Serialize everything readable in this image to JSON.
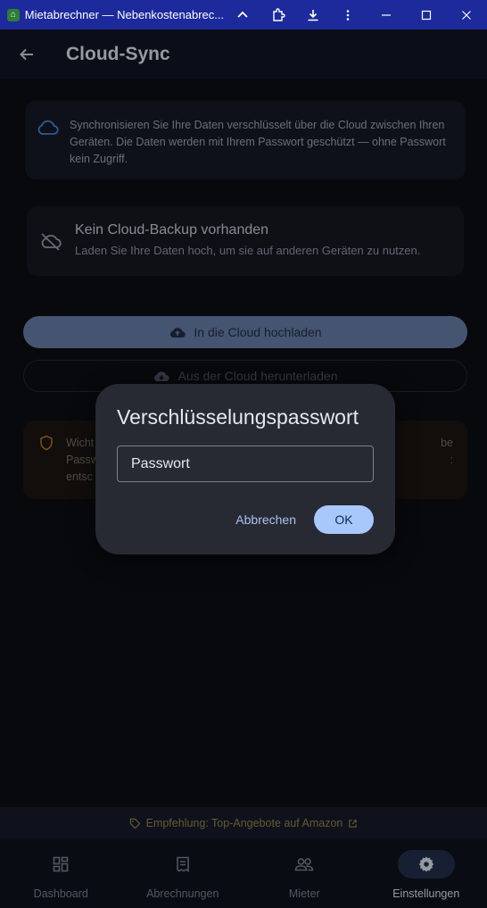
{
  "window": {
    "title": "Mietabrechner — Nebenkostenabrec..."
  },
  "header": {
    "title": "Cloud-Sync"
  },
  "info": {
    "text": "Synchronisieren Sie Ihre Daten verschlüsselt über die Cloud zwischen Ihren Geräten. Die Daten werden mit Ihrem Passwort geschützt — ohne Passwort kein Zugriff."
  },
  "status": {
    "title": "Kein Cloud-Backup vorhanden",
    "subtitle": "Laden Sie Ihre Daten hoch, um sie auf anderen Geräten zu nutzen."
  },
  "actions": {
    "upload_label": "In die Cloud hochladen",
    "download_label": "Aus der Cloud herunterladen"
  },
  "warning": {
    "line1_start": "Wicht",
    "line1_end": "be",
    "line2_start": "Passw",
    "line2_end": ":",
    "line3_start": "entsc"
  },
  "dialog": {
    "title": "Verschlüsselungspasswort",
    "placeholder": "Passwort",
    "cancel_label": "Abbrechen",
    "ok_label": "OK"
  },
  "promo": {
    "text": "Empfehlung: Top-Angebote auf Amazon"
  },
  "nav": {
    "items": [
      {
        "label": "Dashboard",
        "icon": "dashboard-icon"
      },
      {
        "label": "Abrechnungen",
        "icon": "receipt-icon"
      },
      {
        "label": "Mieter",
        "icon": "people-icon"
      },
      {
        "label": "Einstellungen",
        "icon": "gear-icon",
        "active": true
      }
    ]
  },
  "colors": {
    "titlebar": "#1c2a9c",
    "accent": "#a8c7fa",
    "promo": "#857a3f"
  }
}
